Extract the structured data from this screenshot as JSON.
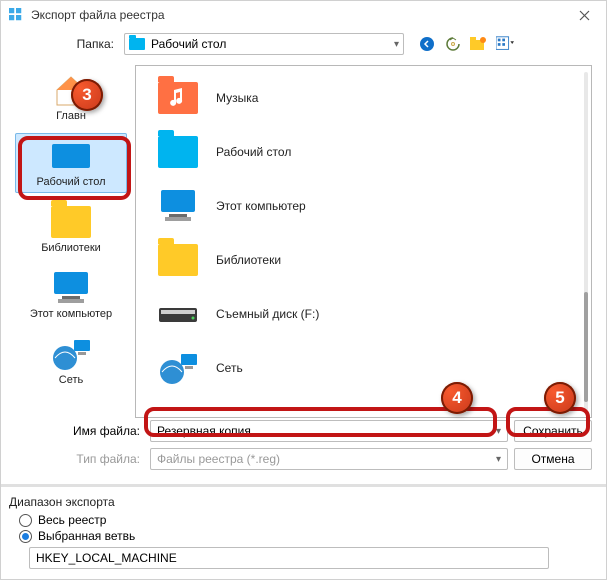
{
  "title": "Экспорт файла реестра",
  "folder_label": "Папка:",
  "folder_value": "Рабочий стол",
  "sidebar": [
    {
      "label": "Главн",
      "kind": "home"
    },
    {
      "label": "Рабочий стол",
      "kind": "desktop"
    },
    {
      "label": "Библиотеки",
      "kind": "libraries"
    },
    {
      "label": "Этот компьютер",
      "kind": "computer"
    },
    {
      "label": "Сеть",
      "kind": "network"
    }
  ],
  "files": [
    {
      "name": "Музыка",
      "kind": "music"
    },
    {
      "name": "Рабочий стол",
      "kind": "desktop"
    },
    {
      "name": "Этот компьютер",
      "kind": "computer"
    },
    {
      "name": "Библиотеки",
      "kind": "libraries"
    },
    {
      "name": "Съемный диск (F:)",
      "kind": "removable"
    },
    {
      "name": "Сеть",
      "kind": "network"
    }
  ],
  "filename_label": "Имя файла:",
  "filename_value": "Резервная копия",
  "filetype_label": "Тип файла:",
  "filetype_value": "Файлы реестра (*.reg)",
  "save_label": "Сохранить",
  "cancel_label": "Отмена",
  "range_title": "Диапазон экспорта",
  "range_full": "Весь реестр",
  "range_branch": "Выбранная ветвь",
  "branch_value": "HKEY_LOCAL_MACHINE",
  "badges": {
    "3": "3",
    "4": "4",
    "5": "5"
  }
}
